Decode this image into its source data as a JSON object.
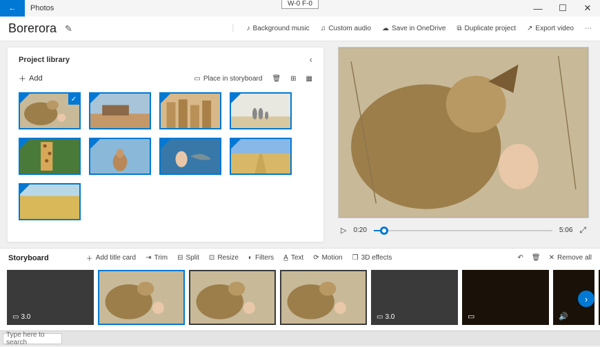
{
  "titlebar": {
    "app_name": "Photos",
    "badge": "W-0  F-0"
  },
  "toolbar": {
    "project_title": "Borerora",
    "bg_music": "Background music",
    "custom_audio": "Custom audio",
    "save_onedrive": "Save in OneDrive",
    "duplicate": "Duplicate project",
    "export": "Export video"
  },
  "library": {
    "title": "Project library",
    "add_label": "Add",
    "place_label": "Place in storyboard",
    "thumbs": [
      {
        "name": "lion-child",
        "selected": true
      },
      {
        "name": "desert-mesa"
      },
      {
        "name": "city-buildings"
      },
      {
        "name": "beach-family"
      },
      {
        "name": "giraffe"
      },
      {
        "name": "deer"
      },
      {
        "name": "girl-dolphin"
      },
      {
        "name": "field-road"
      },
      {
        "name": "savanna"
      }
    ]
  },
  "preview": {
    "current_time": "0:20",
    "total_time": "5:06"
  },
  "storyboard": {
    "title": "Storyboard",
    "add_title_card": "Add title card",
    "trim": "Trim",
    "split": "Split",
    "resize": "Resize",
    "filters": "Filters",
    "text": "Text",
    "motion": "Motion",
    "effects": "3D effects",
    "remove_all": "Remove all",
    "clips": [
      {
        "dur": "3.0",
        "type": "blank"
      },
      {
        "type": "lion",
        "selected": true
      },
      {
        "type": "lion"
      },
      {
        "type": "lion"
      },
      {
        "dur": "3.0",
        "type": "blank"
      },
      {
        "type": "dark",
        "icon": "image"
      },
      {
        "type": "dark",
        "icon": "sound",
        "narrow": true
      },
      {
        "type": "dark",
        "icon": "image",
        "narrow": true
      }
    ]
  },
  "taskbar": {
    "search_placeholder": "Type here to search"
  }
}
